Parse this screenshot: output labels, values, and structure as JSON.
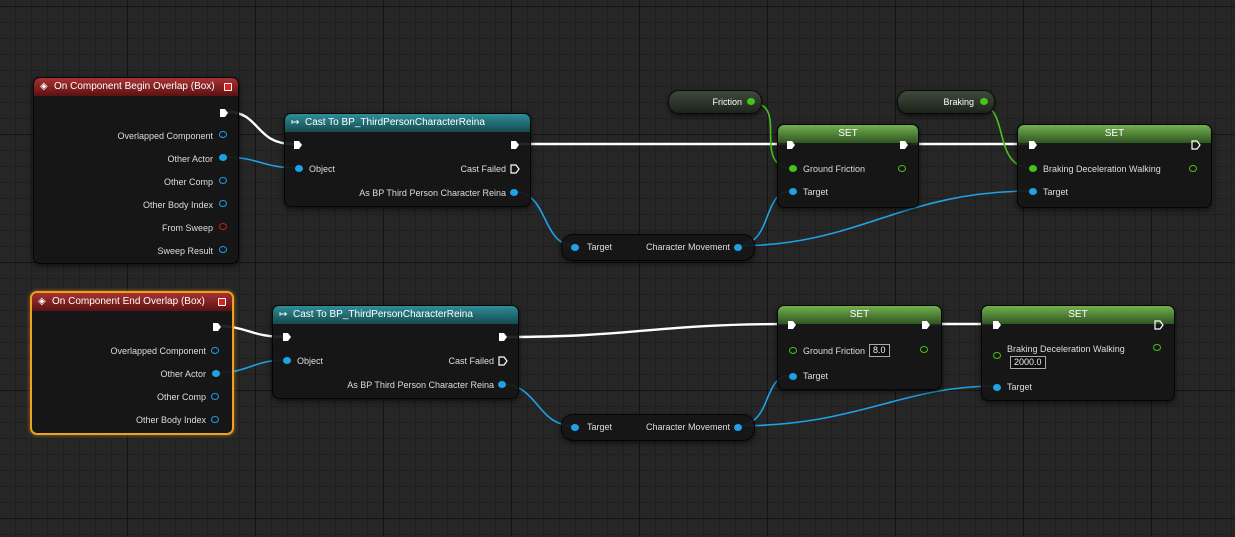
{
  "begin_event": {
    "title": "On Component Begin Overlap (Box)",
    "pins": [
      "Overlapped Component",
      "Other Actor",
      "Other Comp",
      "Other Body Index",
      "From Sweep",
      "Sweep Result"
    ]
  },
  "end_event": {
    "title": "On Component End Overlap (Box)",
    "pins": [
      "Overlapped Component",
      "Other Actor",
      "Other Comp",
      "Other Body Index"
    ]
  },
  "cast_top": {
    "title": "Cast To BP_ThirdPersonCharacterReina",
    "object": "Object",
    "failed": "Cast Failed",
    "as_out": "As BP Third Person Character Reina"
  },
  "cast_bottom": {
    "title": "Cast To BP_ThirdPersonCharacterReina",
    "object": "Object",
    "failed": "Cast Failed",
    "as_out": "As BP Third Person Character Reina"
  },
  "getter_top": {
    "target": "Target",
    "output": "Character Movement"
  },
  "getter_bottom": {
    "target": "Target",
    "output": "Character Movement"
  },
  "var_friction": {
    "label": "Friction"
  },
  "var_braking": {
    "label": "Braking"
  },
  "set_friction_top": {
    "title": "SET",
    "property": "Ground Friction",
    "target": "Target"
  },
  "set_braking_top": {
    "title": "SET",
    "property": "Braking Deceleration Walking",
    "target": "Target"
  },
  "set_friction_bottom": {
    "title": "SET",
    "property": "Ground Friction",
    "value": "8.0",
    "target": "Target"
  },
  "set_braking_bottom": {
    "title": "SET",
    "property": "Braking Deceleration Walking",
    "value": "2000.0",
    "target": "Target"
  },
  "colors": {
    "exec": "#ffffff",
    "object_pin": "#1ea2e6",
    "float_pin": "#46c21a",
    "event_header": "#a83232",
    "cast_header": "#2f8d97",
    "set_header": "#73b04e",
    "selection": "#f0a020"
  },
  "icons": {
    "event": "event-diamond-icon",
    "cast": "cast-arrow-icon",
    "close": "close-square-icon",
    "exec": "exec-arrow-icon"
  }
}
